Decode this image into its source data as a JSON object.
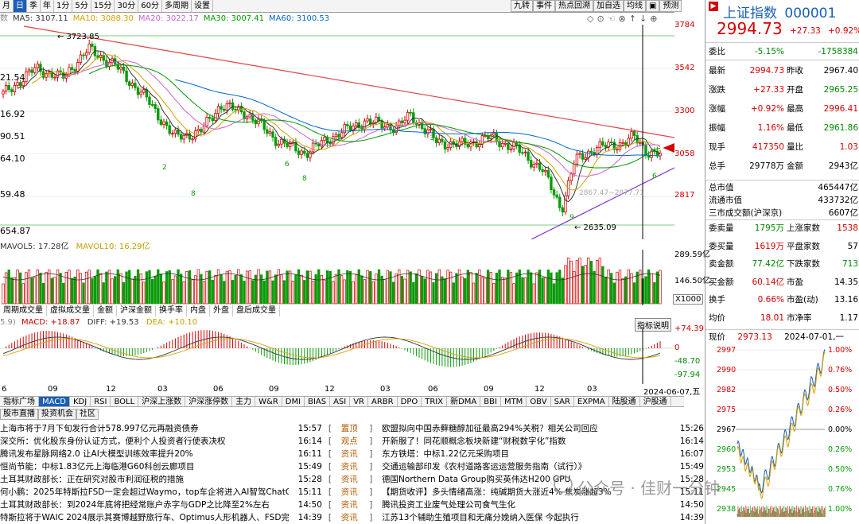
{
  "toolbar": {
    "periods": [
      "月",
      "季",
      "年",
      "1分",
      "5分",
      "15分",
      "30分",
      "60分",
      "多周期",
      "设置"
    ],
    "active_period": "日",
    "right_buttons": [
      "九转",
      "事件",
      "热点回溯",
      "加自选",
      "均线",
      "▣",
      "预测"
    ]
  },
  "ma": {
    "prefix": "数",
    "items": [
      {
        "label": "MA5: 3107.11",
        "color": "#333333"
      },
      {
        "label": "MA10: 3088.30",
        "color": "#d6a000"
      },
      {
        "label": "MA20: 3022.17",
        "color": "#cc66cc"
      },
      {
        "label": "MA30: 3007.41",
        "color": "#009900"
      },
      {
        "label": "MA60: 3100.53",
        "color": "#0066cc"
      }
    ],
    "controls": "◇⊙☜⊗↑↓⊕"
  },
  "kline": {
    "price_axis": [
      "3784",
      "3542",
      "3300",
      "3058",
      "2817"
    ],
    "left_labels": [
      "21.54",
      "16.92",
      "90.51",
      "64.10",
      "59.48",
      "654.87"
    ],
    "high_label": "3723.85",
    "low_label": "2635.09",
    "mid_label": "2867.47~2877.71"
  },
  "volume": {
    "title": "MAVOL5: 17.28亿",
    "title2": "MAVOL10: 16.29亿",
    "axis": [
      "289.59亿",
      "146.50亿"
    ],
    "unit": "X1000",
    "tabs": [
      "周期成交量",
      "虚拟成交量",
      "金额",
      "沪深金额",
      "换手率",
      "内盘",
      "外盘",
      "盘后成交量"
    ]
  },
  "macd": {
    "prefix": "5.9)",
    "macd": "MACD: +18.87",
    "diff": "DIFF: +19.53",
    "dea": "DEA: +10.10",
    "button": "指标说明",
    "axis": [
      "+74.39",
      "0",
      "-48.70",
      "-97.94"
    ]
  },
  "xaxis": [
    "6",
    "09",
    "12",
    "03",
    "06",
    "09",
    "12",
    "03",
    "06",
    "09",
    "12",
    "03"
  ],
  "xaxis_date": "2024-06-07,五",
  "indicator_tabs": [
    "指标广场",
    "MACD",
    "KDJ",
    "RSI",
    "BOLL",
    "沪深上涨数",
    "沪深涨停数",
    "主力",
    "W&R",
    "DMI",
    "BIAS",
    "ASI",
    "VR",
    "ARBR",
    "DPO",
    "TRIX",
    "新DMA",
    "BBI",
    "MTM",
    "OBV",
    "SAR",
    "EXPMA",
    "陆股通",
    "沪股通"
  ],
  "news_tabs": [
    "股市直播",
    "投资机会",
    "社区"
  ],
  "news": [
    {
      "left": "上海市将于7月下旬发行合计578.997亿元再融资债券",
      "t1": "15:57",
      "tag": "置顶",
      "mid": "欧盟拟向中国赤藓糖醇加征最高294%关税？相关公司回应",
      "t2": "15:26"
    },
    {
      "left": "深交所：优化股东身份认证方式，便利个人投资者行使表决权",
      "t1": "16:14",
      "tag": "观点",
      "mid": "开新服了！同花顺概念板块新建“财税数字化”指数",
      "t2": "16:14"
    },
    {
      "left": "腾讯发布星脉网络2.0 让AI大模型训练效率提升20%",
      "t1": "16:11",
      "tag": "资讯",
      "mid": "东方铁塔：中标1.22亿元采购项目",
      "t2": "16:07"
    },
    {
      "left": "恒尚节能：中标1.83亿元上海临港G60科创云廊项目",
      "t1": "15:49",
      "tag": "资讯",
      "mid": "交通运输部印发《农村道路客运运营服务指南（试行）》",
      "t2": "15:49"
    },
    {
      "left": "土耳其财政部长：正在研究对股市利润征税的措施",
      "t1": "15:28",
      "tag": "资讯",
      "mid": "德国Northern Data Group购买英伟达H200 GPU",
      "t2": "15:28"
    },
    {
      "left": "何小鹏：2025年特斯拉FSD一定会超过Waymo，top车企将进入AI智驾ChatGPT…",
      "t1": "15:11",
      "tag": "资讯",
      "mid": "【期货收评】多头情绪高涨：纯碱期货大涨近4% 焦炭涨超3%",
      "t2": "15:11"
    },
    {
      "left": "土耳其财政部长：到2024年底将把经常账户赤字与GDP之比降至2%左右",
      "t1": "14:50",
      "tag": "资讯",
      "mid": "腾讯投资工业废气处理公司食气生化",
      "t2": "14:50"
    },
    {
      "left": "特斯拉将于WAIC 2024展示其赛博越野旅行车、Optimus人形机器人、FSD完全自…",
      "t1": "14:39",
      "tag": "资讯",
      "mid": "江苏13个辅助生殖项目和无痛分娩纳入医保 今起执行",
      "t2": "14:39"
    }
  ],
  "watermark": "公众号 · 佳财一分钟",
  "quote": {
    "name": "上证指数",
    "code": "000001",
    "price": "2994.73",
    "change": "+27.33",
    "pct": "+0.92%",
    "rows": [
      {
        "l1": "委比",
        "v1": "-5.15%",
        "c1": "green",
        "l2": "",
        "v2": "-1758384",
        "c2": "green"
      },
      {
        "l1": "最新",
        "v1": "2994.73",
        "c1": "red",
        "l2": "昨收",
        "v2": "2967.40",
        "c2": "black"
      },
      {
        "l1": "涨跌",
        "v1": "+27.33",
        "c1": "red",
        "l2": "开盘",
        "v2": "2965.25",
        "c2": "green"
      },
      {
        "l1": "涨幅",
        "v1": "+0.92%",
        "c1": "red",
        "l2": "最高",
        "v2": "2996.41",
        "c2": "red"
      },
      {
        "l1": "振幅",
        "v1": "1.16%",
        "c1": "red",
        "l2": "最低",
        "v2": "2961.86",
        "c2": "green"
      },
      {
        "l1": "现手",
        "v1": "417350",
        "c1": "red",
        "l2": "量比",
        "v2": "1.03",
        "c2": "red"
      },
      {
        "l1": "总手",
        "v1": "29778万",
        "c1": "black",
        "l2": "金额",
        "v2": "2943亿",
        "c2": "black"
      }
    ],
    "caps": [
      {
        "l": "总市值",
        "v": "465447亿"
      },
      {
        "l": "流通市值",
        "v": "433732亿"
      },
      {
        "l": "三市成交额(沪深京)",
        "v": "6607亿"
      }
    ],
    "rows2": [
      {
        "l1": "委卖量",
        "v1": "1795万",
        "c1": "green",
        "l2": "上涨家数",
        "v2": "1538",
        "c2": "red"
      },
      {
        "l1": "委买量",
        "v1": "1619万",
        "c1": "red",
        "l2": "平盘家数",
        "v2": "57",
        "c2": "black"
      },
      {
        "l1": "卖金额",
        "v1": "77.42亿",
        "c1": "green",
        "l2": "下跌家数",
        "v2": "713",
        "c2": "green"
      },
      {
        "l1": "买金额",
        "v1": "60.14亿",
        "c1": "red",
        "l2": "市盈",
        "v2": "14.35",
        "c2": "black"
      },
      {
        "l1": "换手",
        "v1": "0.66%",
        "c1": "red",
        "l2": "市盈(动)",
        "v2": "13.16",
        "c2": "black"
      },
      {
        "l1": "均价",
        "v1": "18.01",
        "c1": "red",
        "l2": "市净率",
        "v2": "1.17",
        "c2": "black"
      }
    ],
    "intraday": {
      "label": "现价",
      "price": "2973.13",
      "date": "2024-07-01,一",
      "axis_left": [
        "2997",
        "2990",
        "2982",
        "2975",
        "2967",
        "2960",
        "2953",
        "2945",
        "2938"
      ],
      "axis_right": [
        "1.00%",
        "0.76%",
        "0.50%",
        "0.26%",
        "0.00%",
        "0.26%",
        "0.50%",
        "0.76%",
        "1.00%"
      ]
    }
  }
}
